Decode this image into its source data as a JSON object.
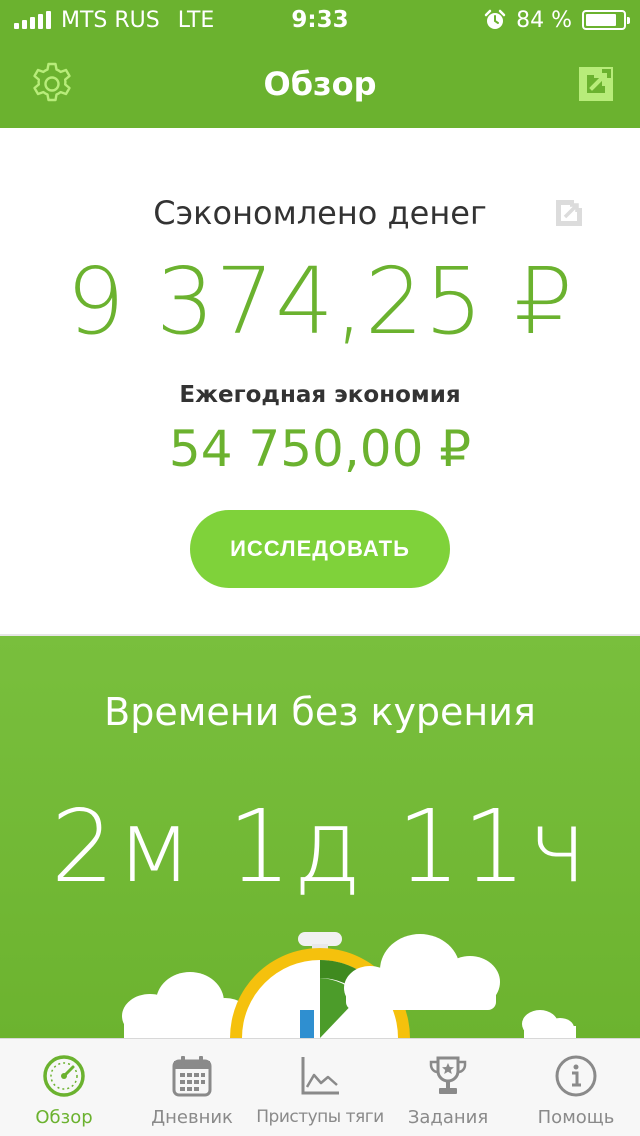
{
  "status_bar": {
    "carrier": "MTS RUS",
    "network": "LTE",
    "time": "9:33",
    "battery_percent": "84 %",
    "battery_level": 0.84
  },
  "header": {
    "title": "Обзор"
  },
  "savings": {
    "label": "Сэкономлено денег",
    "value": "9 374,25 ₽",
    "annual_label": "Ежегодная экономия",
    "annual_value": "54 750,00 ₽",
    "explore_label": "ИССЛЕДОВАТЬ"
  },
  "smoke_free": {
    "label": "Времени без курения",
    "value": "2м 1д 11ч"
  },
  "tabs": [
    {
      "label": "Обзор",
      "icon": "speedometer-icon",
      "active": true
    },
    {
      "label": "Дневник",
      "icon": "calendar-icon",
      "active": false
    },
    {
      "label": "Приступы тяги",
      "icon": "chart-icon",
      "active": false
    },
    {
      "label": "Задания",
      "icon": "trophy-icon",
      "active": false
    },
    {
      "label": "Помощь",
      "icon": "info-icon",
      "active": false
    }
  ],
  "colors": {
    "brand_green": "#6bb22f",
    "button_green": "#7fd23a",
    "tab_inactive": "#8a8a8a"
  }
}
